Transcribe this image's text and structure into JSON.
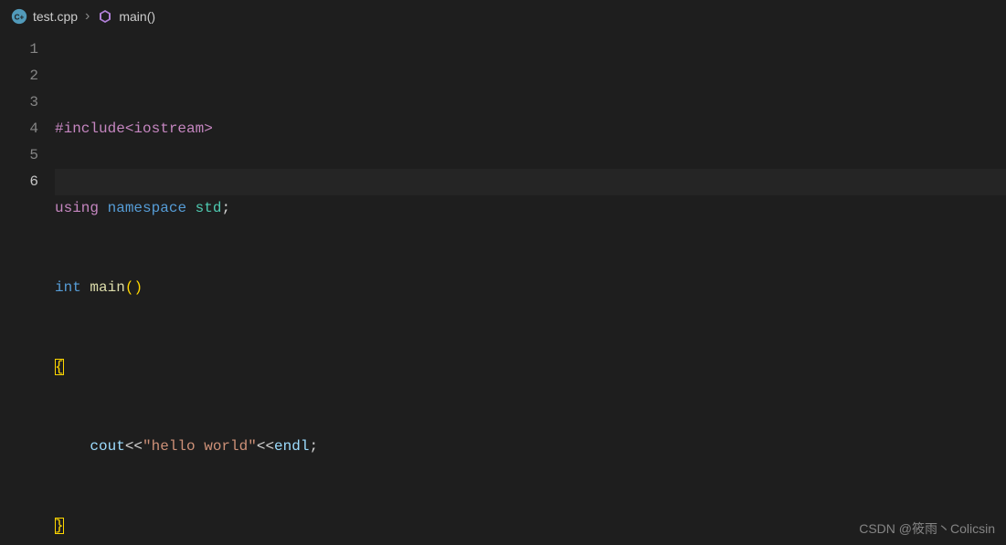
{
  "breadcrumb": {
    "file_icon": "cpp-file-icon",
    "file_name": "test.cpp",
    "separator": "›",
    "symbol_icon": "symbol-method-icon",
    "symbol_name": "main()"
  },
  "gutter": {
    "lines": [
      "1",
      "2",
      "3",
      "4",
      "5",
      "6"
    ],
    "active_line": 6
  },
  "code": {
    "line1": {
      "directive": "#include",
      "angle_open": "<",
      "header": "iostream",
      "angle_close": ">"
    },
    "line2": {
      "kw_using": "using",
      "kw_namespace": "namespace",
      "ns": "std",
      "semi": ";"
    },
    "line3": {
      "type": "int",
      "func": "main",
      "paren_open": "(",
      "paren_close": ")"
    },
    "line4": {
      "brace_open": "{"
    },
    "line5": {
      "indent": "    ",
      "cout": "cout",
      "lshift1": "<<",
      "str": "\"hello world\"",
      "lshift2": "<<",
      "endl": "endl",
      "semi": ";"
    },
    "line6": {
      "brace_close": "}"
    }
  },
  "watermark": "CSDN @筱雨丶Colicsin"
}
